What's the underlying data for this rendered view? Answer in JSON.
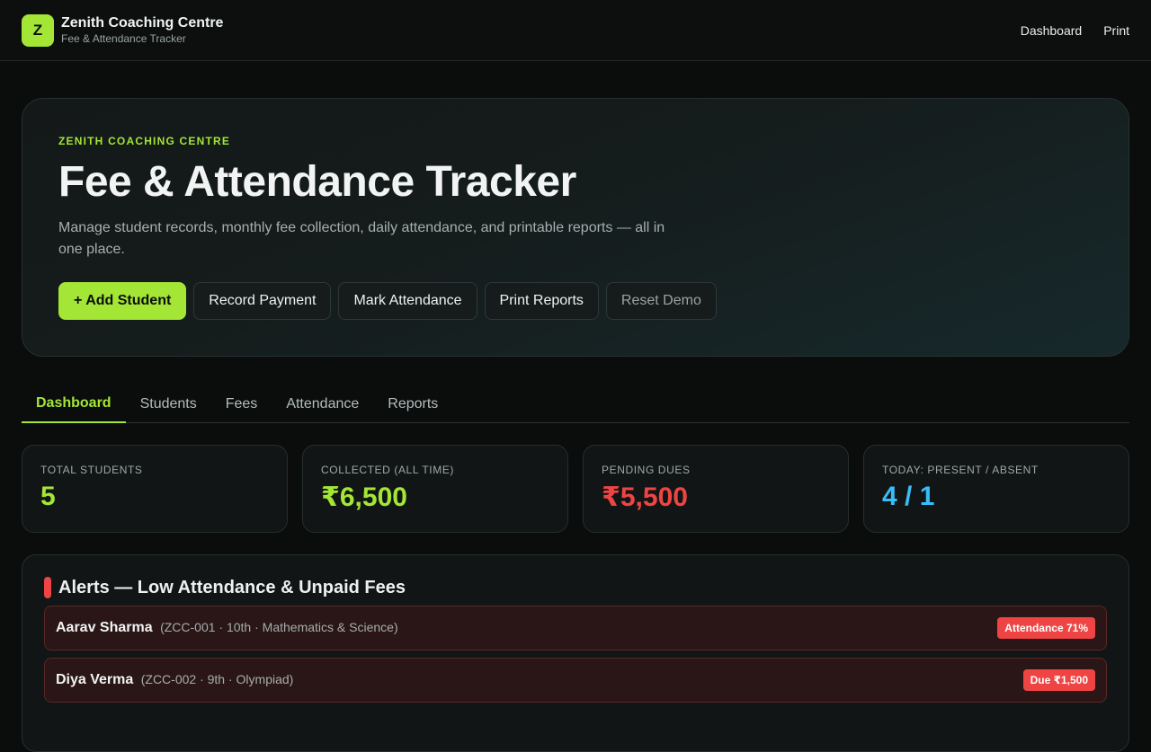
{
  "header": {
    "logo_letter": "Z",
    "brand_name": "Zenith Coaching Centre",
    "brand_sub": "Fee & Attendance Tracker",
    "nav": [
      "Dashboard",
      "Print"
    ]
  },
  "hero": {
    "eyebrow": "ZENITH COACHING CENTRE",
    "title": "Fee & Attendance Tracker",
    "description": "Manage student records, monthly fee collection, daily attendance, and printable reports — all in one place.",
    "buttons": [
      "+ Add Student",
      "Record Payment",
      "Mark Attendance",
      "Print Reports",
      "Reset Demo"
    ]
  },
  "tabs": [
    "Dashboard",
    "Students",
    "Fees",
    "Attendance",
    "Reports"
  ],
  "active_tab": "Dashboard",
  "stats": [
    {
      "label": "TOTAL STUDENTS",
      "value": "5",
      "color": "#a3e635"
    },
    {
      "label": "COLLECTED (ALL TIME)",
      "value": "₹6,500",
      "color": "#a3e635"
    },
    {
      "label": "PENDING DUES",
      "value": "₹5,500",
      "color": "#ef4444"
    },
    {
      "label": "TODAY: PRESENT / ABSENT",
      "value": "4 / 1",
      "color": "#38bdf8"
    }
  ],
  "alerts": {
    "title": "Alerts — Low Attendance & Unpaid Fees",
    "items": [
      {
        "name": "Aarav Sharma",
        "meta": "(ZCC-001 · 10th · Mathematics & Science)",
        "badge": "Attendance 71%"
      },
      {
        "name": "Diya Verma",
        "meta": "(ZCC-002 · 9th · Olympiad)",
        "badge": "Due ₹1,500"
      }
    ]
  }
}
